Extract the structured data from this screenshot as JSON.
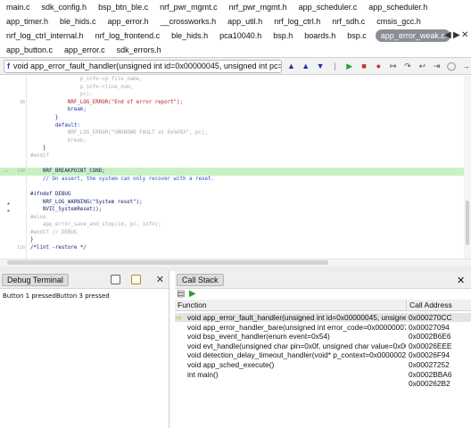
{
  "tabs": {
    "row1": [
      "main.c",
      "sdk_config.h",
      "bsp_btn_ble.c",
      "nrf_pwr_mgmt.c",
      "nrf_pwr_mgmt.h",
      "app_scheduler.c",
      "app_scheduler.h"
    ],
    "row2": [
      "app_timer.h",
      "ble_hids.c",
      "app_error.h",
      "__crossworks.h",
      "app_util.h",
      "nrf_log_ctrl.h",
      "nrf_sdh.c",
      "cmsis_gcc.h"
    ],
    "row3": [
      "nrf_log_ctrl_internal.h",
      "nrf_log_frontend.c",
      "ble_hids.h",
      "pca10040.h",
      "bsp.h",
      "boards.h",
      "bsp.c",
      "app_error_weak.c"
    ],
    "row4": [
      "app_button.c",
      "app_error.c",
      "sdk_errors.h"
    ],
    "active": "app_error_weak.c"
  },
  "toolbar": {
    "function_selector": "void app_error_fault_handler(unsigned int id=0x00000045, unsigned int pc=0x40000"
  },
  "code": {
    "lines": [
      {
        "num": "",
        "text": "                p_info->p_file_name,",
        "style": "gray"
      },
      {
        "num": "",
        "text": "                p_info->line_num,",
        "style": "gray"
      },
      {
        "num": "",
        "text": "                pc);",
        "style": "gray"
      },
      {
        "num": "98",
        "text": "            NRF_LOG_ERROR(\"End of error report\");",
        "style": "red"
      },
      {
        "num": "",
        "text": "            break;",
        "style": "kw"
      },
      {
        "num": "",
        "text": "        }",
        "style": "dk"
      },
      {
        "num": "",
        "text": "        default:",
        "style": "kw"
      },
      {
        "num": "",
        "text": "            NRF_LOG_ERROR(\"UNKNOWN FAULT at 0x%08X\", pc);",
        "style": "gray"
      },
      {
        "num": "",
        "text": "            break;",
        "style": "gray"
      },
      {
        "num": "",
        "text": "    }",
        "style": "dk"
      },
      {
        "num": "",
        "text": "#endif",
        "style": "gray"
      },
      {
        "num": "",
        "text": "",
        "style": "dk"
      },
      {
        "num": "100",
        "text": "    NRF_BREAKPOINT_COND;",
        "style": "dk",
        "highlight": true,
        "marker": true
      },
      {
        "num": "",
        "text": "    // On assert, the system can only recover with a reset.",
        "style": "cm"
      },
      {
        "num": "",
        "text": "",
        "style": "dk"
      },
      {
        "num": "",
        "text": "#ifndef DEBUG",
        "style": "dk"
      },
      {
        "num": "",
        "text": "    NRF_LOG_WARNING(\"System reset\");",
        "style": "dk",
        "dot": true
      },
      {
        "num": "",
        "text": "    NVIC_SystemReset();",
        "style": "dk",
        "dot": true
      },
      {
        "num": "",
        "text": "#else",
        "style": "gray"
      },
      {
        "num": "",
        "text": "    app_error_save_and_stop(id, pc, info);",
        "style": "gray"
      },
      {
        "num": "",
        "text": "#endif // DEBUG",
        "style": "gray"
      },
      {
        "num": "",
        "text": "}",
        "style": "dk"
      },
      {
        "num": "110",
        "text": "/*lint -restore */",
        "style": "dk"
      }
    ]
  },
  "debug_terminal": {
    "title": "Debug Terminal",
    "output": "Button 1 pressedButton 3 pressed"
  },
  "call_stack": {
    "title": "Call Stack",
    "columns": [
      "Function",
      "Call Address"
    ],
    "rows": [
      {
        "function": "void app_error_fault_handler(unsigned int id=0x00000045, unsigned",
        "address": "0x000270CC",
        "current": true
      },
      {
        "function": "void app_error_handler_bare(unsigned int error_code=0x00000007)",
        "address": "0x00027094"
      },
      {
        "function": "void bsp_event_handler(enum event=0x54)",
        "address": "0x0002B6E6"
      },
      {
        "function": "void evt_handle(unsigned char pin=0x0f, unsigned char value=0x00)",
        "address": "0x00026EEE"
      },
      {
        "function": "void detection_delay_timeout_handler(void* p_context=0x0000002d",
        "address": "0x00026F94"
      },
      {
        "function": "void app_sched_execute()",
        "address": "0x00027252"
      },
      {
        "function": "int main()",
        "address": "0x0002BBA6"
      },
      {
        "function": "",
        "address": "0x000262B2"
      }
    ]
  }
}
